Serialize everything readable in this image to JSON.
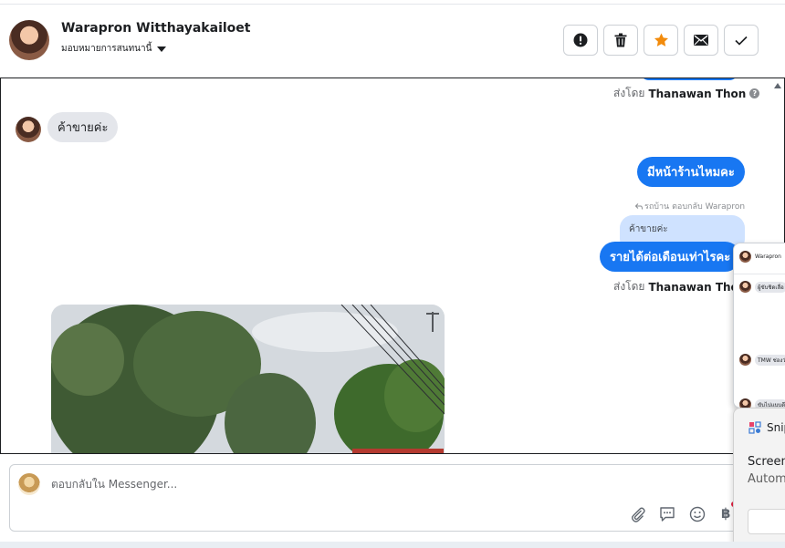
{
  "header": {
    "contact_name": "Warapron Witthayakailoet",
    "assign_label": "มอบหมายการสนทนานี้"
  },
  "thread": {
    "top_sent_by": {
      "prefix": "ส่งโดย",
      "agent": "Thanawan Thon"
    },
    "incoming_1": "ค้าขายค่ะ",
    "outgoing_1": "มีหน้าร้านไหมคะ",
    "reply_note": "รถบ้าน ตอบกลับ Warapron",
    "quoted_text": "ค้าขายค่ะ",
    "outgoing_2": "รายได้ต่อเดือนเท่าไรคะ",
    "bottom_sent_by": {
      "prefix": "ส่งโดย",
      "agent": "Thanawan Thon"
    }
  },
  "popup": {
    "header_name": "Warapron",
    "row1": "ผู้ขับชิดเลื่อ",
    "row2": "TMW ช่องว่",
    "row3": "ขับไปแบบดี"
  },
  "composer": {
    "placeholder": "ตอบกลับใน Messenger...",
    "currency_symbol": "฿"
  },
  "toast": {
    "app_name": "Snipping Tool",
    "title": "Screenshot",
    "subtitle": "Automatically saved"
  },
  "colors": {
    "accent": "#1877f2",
    "star": "#f28b0c"
  }
}
